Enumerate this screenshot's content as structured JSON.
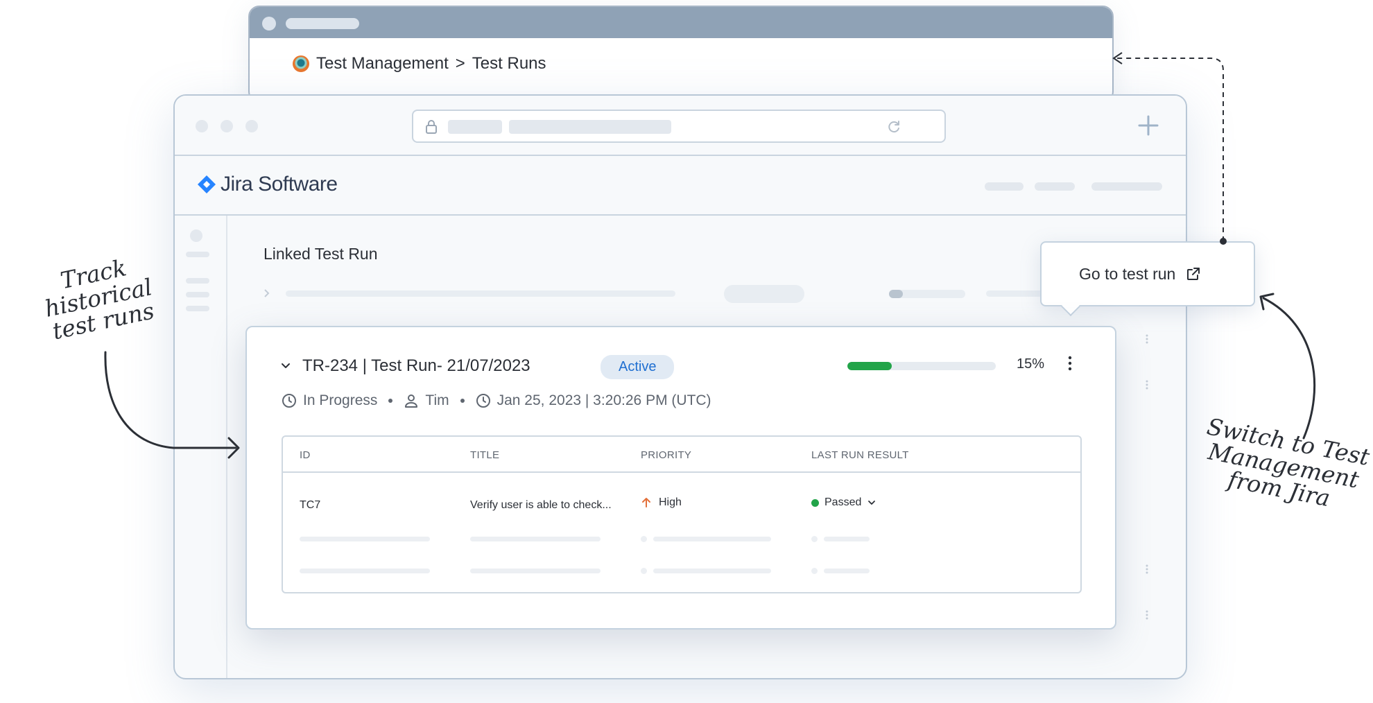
{
  "back_window": {
    "breadcrumb_root": "Test Management",
    "breadcrumb_sep": ">",
    "breadcrumb_current": "Test Runs"
  },
  "jira": {
    "brand": "Jira Software",
    "section_title": "Linked Test Run"
  },
  "popup": {
    "label": "Go to test run"
  },
  "test_run": {
    "title": "TR-234 | Test Run- 21/07/2023",
    "status": "Active",
    "progress_percent": 15,
    "progress_label": "15%",
    "state": "In Progress",
    "assignee": "Tim",
    "timestamp": "Jan 25, 2023 | 3:20:26 PM (UTC)",
    "columns": [
      "ID",
      "TITLE",
      "PRIORITY",
      "LAST RUN RESULT"
    ],
    "rows": [
      {
        "id": "TC7",
        "title": "Verify user is able to check...",
        "priority": "High",
        "result": "Passed"
      }
    ]
  },
  "annotations": {
    "left": "Track historical test runs",
    "right": "Switch to Test Management from Jira"
  },
  "colors": {
    "accent_blue": "#1f6fd1",
    "passed_green": "#22a449",
    "priority_high": "#e3703a"
  }
}
